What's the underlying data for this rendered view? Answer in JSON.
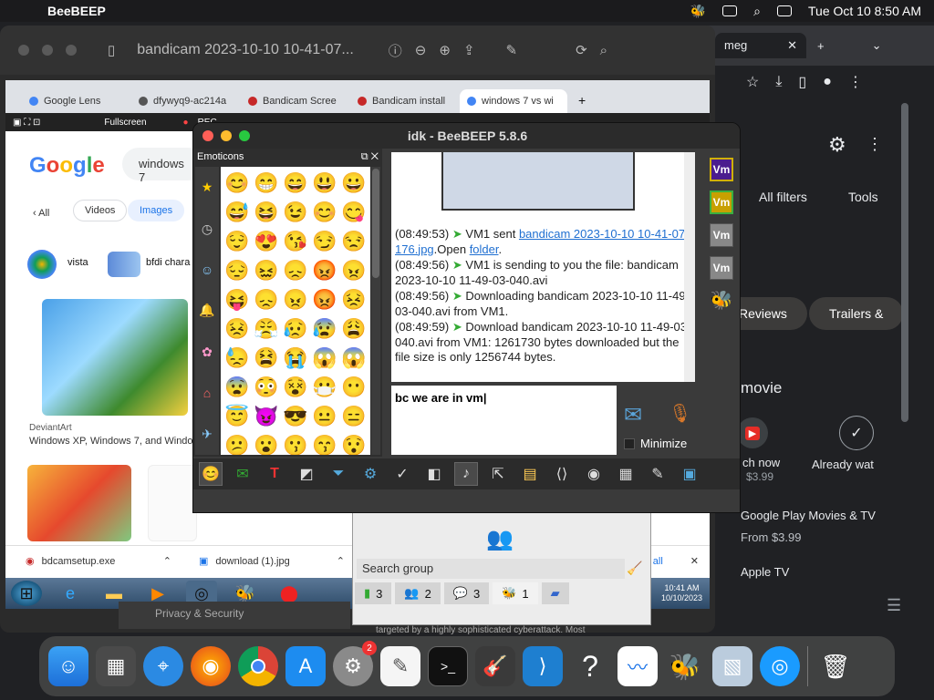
{
  "menubar": {
    "app_name": "BeeBEEP",
    "datetime": "Tue Oct 10  8:50 AM"
  },
  "preview_window": {
    "title": "bandicam 2023-10-10 10-41-07..."
  },
  "chrome_right": {
    "tab_label": "meg",
    "all_filters": "All filters",
    "tools": "Tools",
    "reviews_chip": "Reviews",
    "trailers_chip": "Trailers &",
    "movie_heading": "movie",
    "watch_now": "ch now",
    "price1": "$3.99",
    "already_watched": "Already wat",
    "gp_title": "Google Play Movies & TV",
    "gp_price": "From $3.99",
    "apple_tv": "Apple TV"
  },
  "vm": {
    "tabs": [
      {
        "label": "Google Lens",
        "color": "#4285f4"
      },
      {
        "label": "dfywyq9-ac214a",
        "color": "#555555"
      },
      {
        "label": "Bandicam Scree",
        "color": "#c62828"
      },
      {
        "label": "Bandicam install",
        "color": "#c62828"
      },
      {
        "label": "windows 7 vs wi",
        "color": "#4285f4"
      }
    ],
    "bandicam_bar": {
      "fullscreen": "Fullscreen",
      "rec": "REC"
    },
    "google": {
      "logo": "Google",
      "search_value": "windows 7",
      "chip_all": "All",
      "chip_videos": "Videos",
      "chip_images": "Images",
      "result1": "vista",
      "result2": "bfdi chara",
      "source": "DeviantArt",
      "caption": "Windows XP, Windows 7, and Windo"
    },
    "downloads": [
      {
        "name": "bdcamsetup.exe"
      },
      {
        "name": "download (1).jpg"
      }
    ],
    "downloads_showall": "w all",
    "clock": {
      "time": "10:41 AM",
      "date": "10/10/2023"
    }
  },
  "group_window": {
    "search_placeholder": "Search group",
    "tabs": [
      {
        "icon": "chat-icon",
        "count": "3"
      },
      {
        "icon": "users-icon",
        "count": "2"
      },
      {
        "icon": "groups-icon",
        "count": "3"
      },
      {
        "icon": "bee-users-icon",
        "count": "1"
      },
      {
        "icon": "files-icon",
        "count": ""
      }
    ],
    "behind_text": "targeted by a highly sophisticated cyberattack. Most",
    "behind_link": "Privacy & Security"
  },
  "beebeep": {
    "title": "idk - BeeBEEP 5.8.6",
    "emoticons_label": "Emoticons",
    "emoji_grid": [
      "😊",
      "😁",
      "😄",
      "😃",
      "😀",
      "😅",
      "😆",
      "😉",
      "😊",
      "😋",
      "😌",
      "😍",
      "😘",
      "😏",
      "😒",
      "😔",
      "😖",
      "😞",
      "😡",
      "😠",
      "😝",
      "😞",
      "😠",
      "😡",
      "😣",
      "😣",
      "😤",
      "😥",
      "😰",
      "😩",
      "😓",
      "😫",
      "😭",
      "😱",
      "😱",
      "😨",
      "😳",
      "😵",
      "😷",
      "😶",
      "😇",
      "😈",
      "😎",
      "😐",
      "😑",
      "😕",
      "😮",
      "😗",
      "😙",
      "😯",
      "😟",
      "😦",
      "😬",
      "😮",
      "😲"
    ],
    "messages": [
      {
        "time": "(08:49:53)",
        "prefix": " VM1 sent ",
        "link": "bandicam 2023-10-10 10-41-07-176.jpg",
        "suffix": ".Open ",
        "link2": "folder",
        "end": "."
      },
      {
        "time": "(08:49:56)",
        "text": " VM1 is sending to you the file: bandicam 2023-10-10 11-49-03-040.avi"
      },
      {
        "time": "(08:49:56)",
        "text": " Downloading bandicam 2023-10-10 11-49-03-040.avi from VM1."
      },
      {
        "time": "(08:49:59)",
        "text": " Download bandicam 2023-10-10 11-49-03-040.avi from VM1: 1261730 bytes downloaded but the file size is only 1256744 bytes."
      }
    ],
    "input_value": "bc we are in vm",
    "minimize_label": "Minimize",
    "vm_users": [
      {
        "label": "Vm",
        "bg": "#4b1d8f",
        "border": "#d0b000"
      },
      {
        "label": "Vm",
        "bg": "#c8a000",
        "border": "#3ab040"
      },
      {
        "label": "Vm",
        "bg": "#888888",
        "border": "#777777"
      },
      {
        "label": "Vm",
        "bg": "#888888",
        "border": "#777777"
      }
    ]
  },
  "colors": {
    "traffic_red": "#ff5f57",
    "traffic_yellow": "#febc2e",
    "traffic_green": "#28c840"
  }
}
